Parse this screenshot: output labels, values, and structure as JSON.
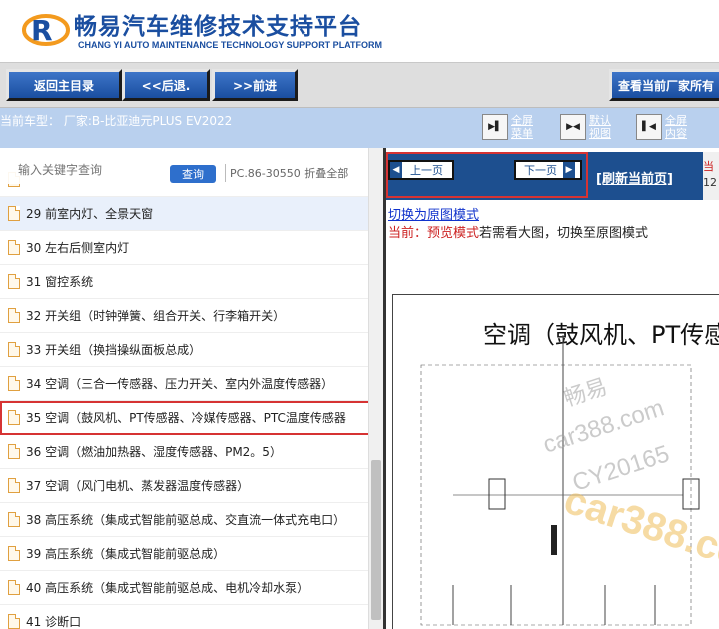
{
  "header": {
    "title": "畅易汽车维修技术支持平台",
    "subtitle": "CHANG YI AUTO MAINTENANCE TECHNOLOGY SUPPORT PLATFORM",
    "brand_color": "#1a4ea0"
  },
  "toolbar": {
    "back_main": "返回主目录",
    "back": "<<后退.",
    "forward": ">>前进",
    "view_factory": "查看当前厂家所有"
  },
  "model": {
    "text": "当前车型： 厂家:B-比亚迪元PLUS EV2022"
  },
  "view_buttons": [
    {
      "label": "全屏菜单",
      "icon": "fullscreen-menu-icon"
    },
    {
      "label": "默认视图",
      "icon": "default-view-icon"
    },
    {
      "label": "全屏内容",
      "icon": "fullscreen-content-icon"
    }
  ],
  "search": {
    "placeholder": "输入关键字查询",
    "button": "查询",
    "phone": "PC.86-30550 折叠全部"
  },
  "list": [
    {
      "label": "29 前室内灯、全景天窗",
      "highlight": true
    },
    {
      "label": "30 左右后侧室内灯"
    },
    {
      "label": "31 窗控系统"
    },
    {
      "label": "32 开关组（时钟弹簧、组合开关、行李箱开关）"
    },
    {
      "label": "33 开关组（换挡操纵面板总成）"
    },
    {
      "label": "34 空调（三合一传感器、压力开关、室内外温度传感器）"
    },
    {
      "label": "35 空调（鼓风机、PT传感器、冷媒传感器、PTC温度传感器",
      "selected": true
    },
    {
      "label": "36 空调（燃油加热器、湿度传感器、PM2。5）"
    },
    {
      "label": "37 空调（风门电机、蒸发器温度传感器）"
    },
    {
      "label": "38 高压系统（集成式智能前驱总成、交直流一体式充电口）"
    },
    {
      "label": "39 高压系统（集成式智能前驱总成）"
    },
    {
      "label": "40 高压系统（集成式智能前驱总成、电机冷却水泵）"
    },
    {
      "label": "41 诊断口"
    }
  ],
  "pager": {
    "prev": "上一页",
    "next": "下一页",
    "refresh": "[刷新当前页]",
    "edge_top": "当",
    "edge_bottom": "12"
  },
  "content": {
    "switch_link": "切换为原图模式",
    "mode_prefix": "当前：预览模式",
    "mode_suffix": "若需看大图，切换至原图模式",
    "diagram_title": "空调（鼓风机、PT传感"
  },
  "watermarks": [
    "畅易",
    "car388.com",
    "CY20165",
    "car388.co"
  ],
  "accent_red": "#d63333"
}
